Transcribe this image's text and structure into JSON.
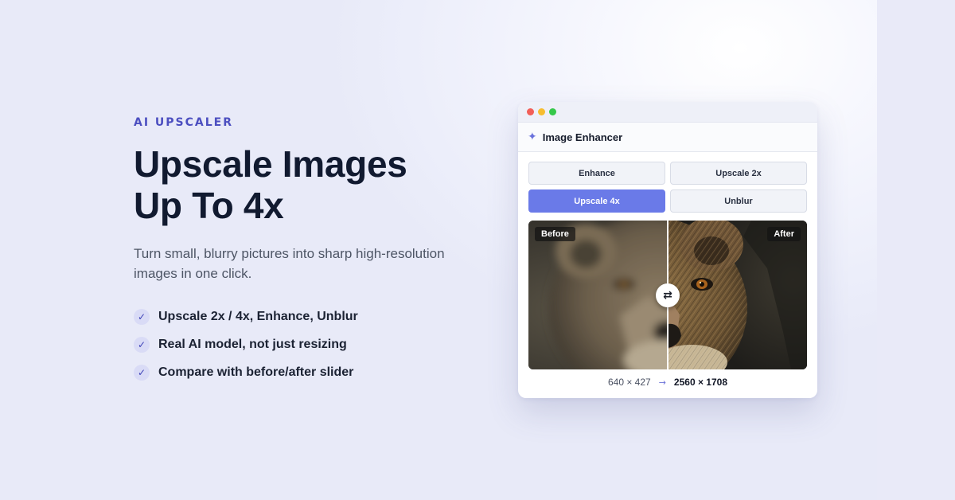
{
  "hero": {
    "eyebrow": "AI UPSCALER",
    "headline_line1": "Upscale Images",
    "headline_line2": "Up To 4x",
    "subtitle": "Turn small, blurry pictures into sharp high-resolution images in one click.",
    "features": [
      {
        "check_icon": "✓",
        "text": "Upscale 2x / 4x, Enhance, Unblur"
      },
      {
        "check_icon": "✓",
        "text": "Real AI model, not just resizing"
      },
      {
        "check_icon": "✓",
        "text": "Compare with before/after slider"
      }
    ]
  },
  "window": {
    "traffic_lights": {
      "close": "#f25f58",
      "minimize": "#f7bd2f",
      "maximize": "#35c84a"
    },
    "sparkle_icon": "✦",
    "title": "Image Enhancer",
    "modes": [
      {
        "label": "Enhance",
        "active": false
      },
      {
        "label": "Upscale 2x",
        "active": false
      },
      {
        "label": "Upscale 4x",
        "active": true
      },
      {
        "label": "Unblur",
        "active": false
      }
    ],
    "compare": {
      "before_label": "Before",
      "after_label": "After",
      "handle_icon": "⇄",
      "slider_position": 0.5
    },
    "resolution": {
      "from": "640 × 427",
      "arrow": "→",
      "to": "2560 × 1708"
    }
  },
  "colors": {
    "accent": "#6a7ae8",
    "eyebrow": "#4c4fc0",
    "headline": "#111a30"
  }
}
